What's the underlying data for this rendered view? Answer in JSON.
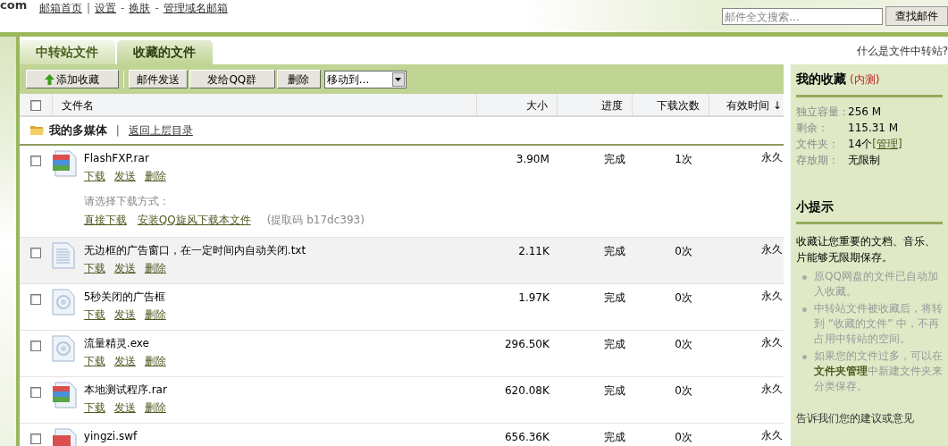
{
  "logo": {
    "text": "com"
  },
  "top_nav": [
    {
      "label": "邮箱首页",
      "sep": "|"
    },
    {
      "label": "设置",
      "sep": "-"
    },
    {
      "label": "换肤",
      "sep": "-"
    },
    {
      "label": "管理域名邮箱"
    }
  ],
  "search": {
    "placeholder": "邮件全文搜索…",
    "button": "查找邮件"
  },
  "help_link": "什么是文件中转站?",
  "tabs": [
    {
      "label": "中转站文件",
      "selected": false
    },
    {
      "label": "收藏的文件",
      "selected": true
    }
  ],
  "toolbar": {
    "add_button": "添加收藏",
    "buttons": [
      "邮件发送",
      "发给QQ群",
      "删除"
    ],
    "move_select": "移动到..."
  },
  "table": {
    "select_all": {
      "checked": false
    },
    "columns": [
      "文件名",
      "大小",
      "进度",
      "下载次数",
      "有效时间 ↓"
    ],
    "folder": {
      "name": "我的多媒体",
      "separator": "|",
      "back_link": "返回上层目录"
    },
    "rows": [
      {
        "kind": "archive",
        "name": "FlashFXP.rar",
        "size": "3.90M",
        "progress": "完成",
        "downloads": "1次",
        "expiry": "永久",
        "checked": false,
        "hovered": false,
        "actions": [
          "下载",
          "发送",
          "删除"
        ],
        "download_options": {
          "prompt": "请选择下载方式：",
          "links": [
            "直接下载",
            "安装QQ旋风下载本文件"
          ],
          "code": "(提取码 b17dc393)"
        }
      },
      {
        "kind": "text",
        "name": "无边框的广告窗口，在一定时间内自动关闭.txt",
        "size": "2.11K",
        "progress": "完成",
        "downloads": "0次",
        "expiry": "永久",
        "checked": false,
        "hovered": true,
        "actions": [
          "下载",
          "发送",
          "删除"
        ]
      },
      {
        "kind": "generic",
        "name": "5秒关闭的广告框",
        "size": "1.97K",
        "progress": "完成",
        "downloads": "0次",
        "expiry": "永久",
        "checked": false,
        "hovered": false,
        "actions": [
          "下载",
          "发送",
          "删除"
        ]
      },
      {
        "kind": "generic",
        "name": "流量精灵.exe",
        "size": "296.50K",
        "progress": "完成",
        "downloads": "0次",
        "expiry": "永久",
        "checked": false,
        "hovered": false,
        "actions": [
          "下载",
          "发送",
          "删除"
        ]
      },
      {
        "kind": "archive",
        "name": "本地测试程序.rar",
        "size": "620.08K",
        "progress": "完成",
        "downloads": "0次",
        "expiry": "永久",
        "checked": false,
        "hovered": false,
        "actions": [
          "下载",
          "发送",
          "删除"
        ]
      },
      {
        "kind": "flash",
        "name": "yingzi.swf",
        "size": "656.36K",
        "progress": "完成",
        "downloads": "0次",
        "expiry": "永久",
        "checked": false,
        "hovered": false,
        "actions": []
      }
    ]
  },
  "sidebar": {
    "title": "我的收藏",
    "badge": "(内测)",
    "stats": [
      {
        "label": "独立容量：",
        "value": "256 M"
      },
      {
        "label": "剩余：",
        "value": "115.31 M"
      },
      {
        "label": "文件夹：",
        "value": "14个",
        "link": "[管理]"
      },
      {
        "label": "存放期：",
        "value": "无限制"
      }
    ],
    "tips_title": "小提示",
    "intro_lines": [
      "收藏让您重要的文档、音乐、",
      "片能够无限期保存。"
    ],
    "tips": [
      [
        "原QQ网盘的文件已自动加",
        "入收藏。"
      ],
      [
        "中转站文件被收藏后，将转",
        "到 “收藏的文件” 中，不再",
        "占用中转站的空间。"
      ],
      [
        "如果您的文件过多，可以在",
        "**文件夹管理**中新建文件夹来",
        "分类保存。"
      ]
    ],
    "feedback_link": "告诉我们您的建议或意见"
  }
}
